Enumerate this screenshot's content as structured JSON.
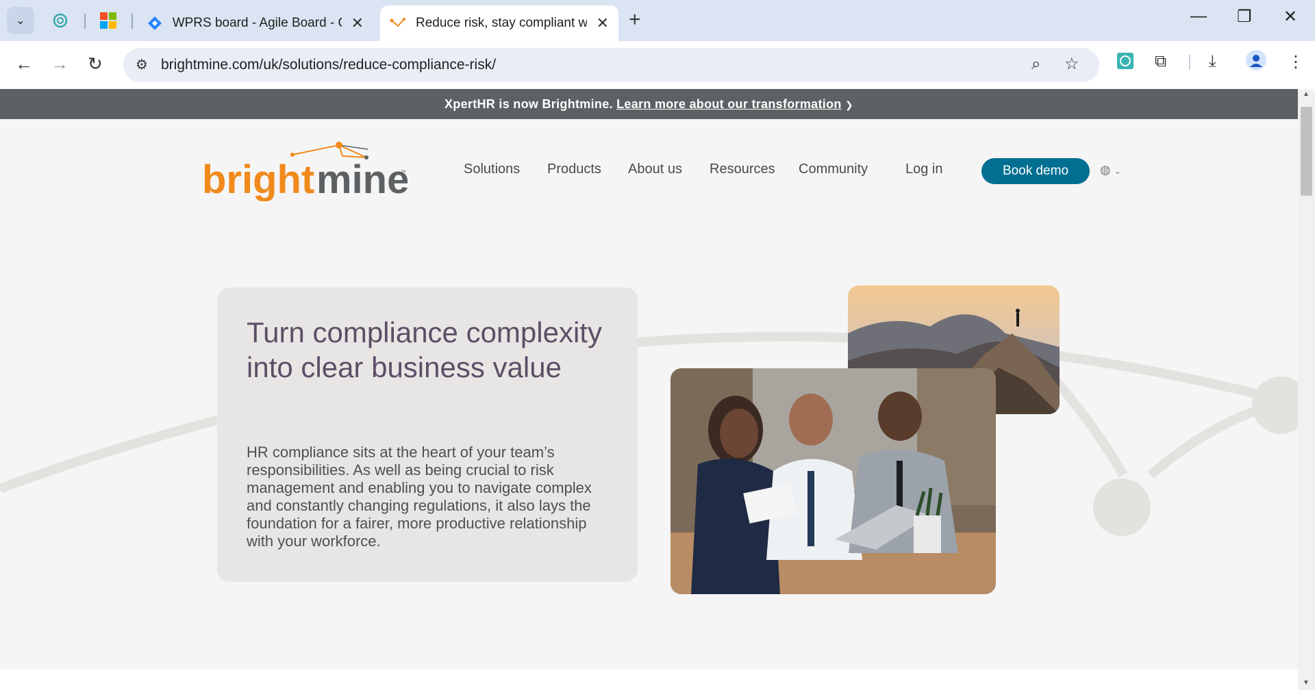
{
  "browser": {
    "tabs": [
      {
        "title": "WPRS board - Agile Board - CE",
        "active": false
      },
      {
        "title": "Reduce risk, stay compliant with",
        "active": true
      }
    ],
    "url": "brightmine.com/uk/solutions/reduce-compliance-risk/"
  },
  "banner": {
    "text": "XpertHR is now Brightmine.",
    "link": "Learn more about our transformation",
    "chevron": "❯"
  },
  "site": {
    "logo_dark": "bright",
    "logo_light": "mine",
    "logo_tm": "™",
    "nav": [
      "Solutions",
      "Products",
      "About us",
      "Resources",
      "Community",
      "Log in"
    ],
    "cta": "Book demo",
    "brand_orange": "#f08a1c",
    "brand_teal": "#006f91"
  },
  "hero": {
    "title": "Turn compliance complexity into clear business value",
    "body": "HR compliance sits at the heart of your team’s responsibilities. As well as being crucial to risk management and enabling you to navigate complex and constantly changing regulations, it also lays the foundation for a fairer, more productive relationship with your workforce."
  }
}
